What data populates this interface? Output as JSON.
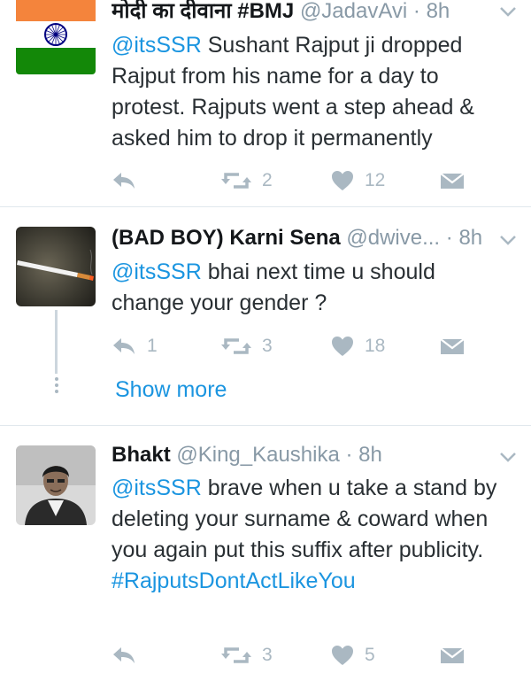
{
  "tweets": [
    {
      "name": "मोदी का दीवाना #BMJ",
      "handle": "@JadavAvi",
      "time": "· 8h",
      "mention": "@itsSSR",
      "text": " Sushant Rajput ji dropped Rajput from his name for a day to protest. Rajputs went a step ahead & asked him to drop it permanently",
      "replies": "",
      "retweets": "2",
      "likes": "12"
    },
    {
      "name": "(BAD BOY) Karni Sena",
      "handle": "@dwive...",
      "time": "· 8h",
      "mention": "@itsSSR",
      "text": " bhai next time u should change your gender ?",
      "replies": "1",
      "retweets": "3",
      "likes": "18",
      "show_more": "Show more"
    },
    {
      "name": "Bhakt",
      "handle": "@King_Kaushika",
      "time": "· 8h",
      "mention": "@itsSSR",
      "text": " brave when u take a stand by deleting your surname & coward when you again put this suffix  after publicity.",
      "hashtag": "#RajputsDontActLikeYou",
      "replies": "",
      "retweets": "3",
      "likes": "5"
    }
  ],
  "colors": {
    "link": "#1b95e0",
    "icon": "#aab8c2",
    "saffron": "#f4843c",
    "green": "#138808",
    "chakra": "#000080"
  },
  "icons": [
    "reply-icon",
    "retweet-icon",
    "heart-icon",
    "direct-message-icon",
    "chevron-down-icon"
  ]
}
